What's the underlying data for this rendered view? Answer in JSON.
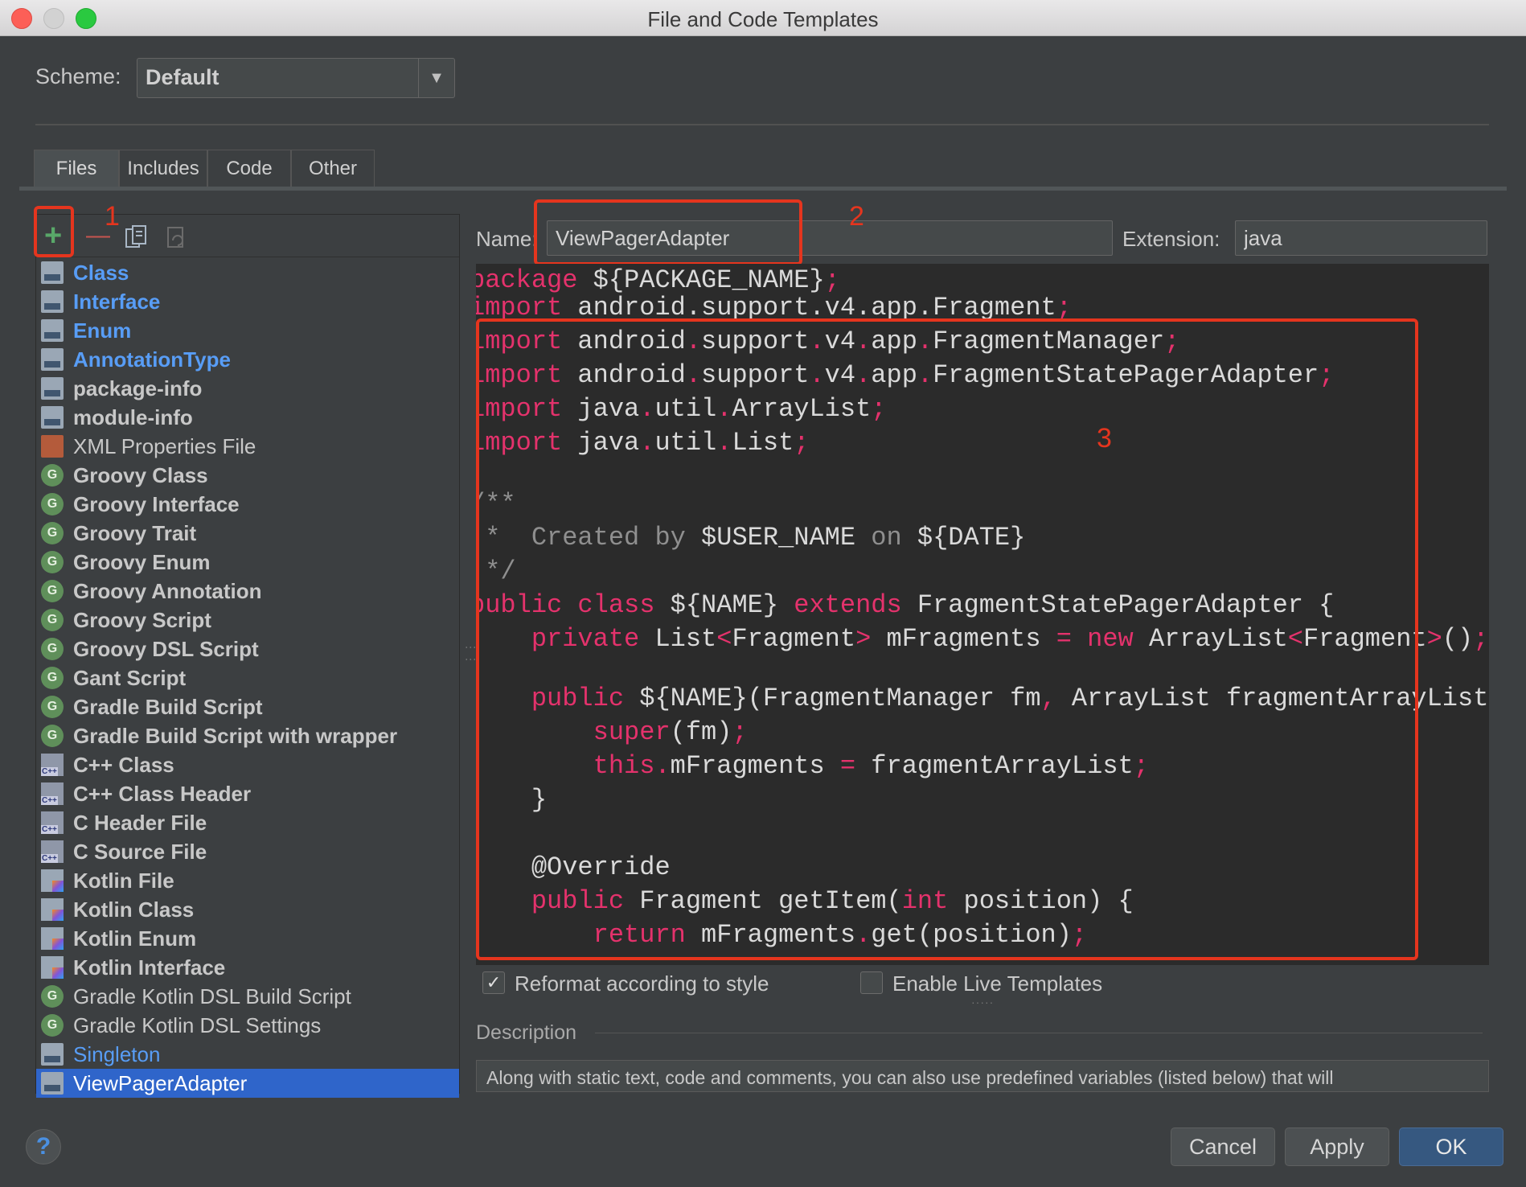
{
  "window": {
    "title": "File and Code Templates"
  },
  "scheme": {
    "label": "Scheme:",
    "value": "Default"
  },
  "tabs": [
    {
      "label": "Files",
      "active": true
    },
    {
      "label": "Includes",
      "active": false
    },
    {
      "label": "Code",
      "active": false
    },
    {
      "label": "Other",
      "active": false
    }
  ],
  "toolbar": {
    "add": "+",
    "remove": "—"
  },
  "templates": [
    {
      "label": "Class",
      "icon": "java-file-icon",
      "style": "blue"
    },
    {
      "label": "Interface",
      "icon": "java-file-icon",
      "style": "blue"
    },
    {
      "label": "Enum",
      "icon": "java-file-icon",
      "style": "blue"
    },
    {
      "label": "AnnotationType",
      "icon": "java-file-icon",
      "style": "blue"
    },
    {
      "label": "package-info",
      "icon": "java-file-icon",
      "style": "bold"
    },
    {
      "label": "module-info",
      "icon": "java-file-icon",
      "style": "bold"
    },
    {
      "label": "XML Properties File",
      "icon": "xml-file-icon",
      "style": "normal"
    },
    {
      "label": "Groovy Class",
      "icon": "groovy-icon",
      "style": "bold"
    },
    {
      "label": "Groovy Interface",
      "icon": "groovy-icon",
      "style": "bold"
    },
    {
      "label": "Groovy Trait",
      "icon": "groovy-icon",
      "style": "bold"
    },
    {
      "label": "Groovy Enum",
      "icon": "groovy-icon",
      "style": "bold"
    },
    {
      "label": "Groovy Annotation",
      "icon": "groovy-icon",
      "style": "bold"
    },
    {
      "label": "Groovy Script",
      "icon": "groovy-icon",
      "style": "bold"
    },
    {
      "label": "Groovy DSL Script",
      "icon": "groovy-icon",
      "style": "bold"
    },
    {
      "label": "Gant Script",
      "icon": "groovy-icon",
      "style": "bold"
    },
    {
      "label": "Gradle Build Script",
      "icon": "groovy-icon",
      "style": "bold"
    },
    {
      "label": "Gradle Build Script with wrapper",
      "icon": "groovy-icon",
      "style": "bold"
    },
    {
      "label": "C++ Class",
      "icon": "cpp-file-icon",
      "style": "bold"
    },
    {
      "label": "C++ Class Header",
      "icon": "cpp-file-icon",
      "style": "bold"
    },
    {
      "label": "C Header File",
      "icon": "cpp-file-icon",
      "style": "bold"
    },
    {
      "label": "C Source File",
      "icon": "cpp-file-icon",
      "style": "bold"
    },
    {
      "label": "Kotlin File",
      "icon": "kotlin-file-icon",
      "style": "bold"
    },
    {
      "label": "Kotlin Class",
      "icon": "kotlin-file-icon",
      "style": "bold"
    },
    {
      "label": "Kotlin Enum",
      "icon": "kotlin-file-icon",
      "style": "bold"
    },
    {
      "label": "Kotlin Interface",
      "icon": "kotlin-file-icon",
      "style": "bold"
    },
    {
      "label": "Gradle Kotlin DSL Build Script",
      "icon": "groovy-icon",
      "style": "normal"
    },
    {
      "label": "Gradle Kotlin DSL Settings",
      "icon": "groovy-icon",
      "style": "normal"
    },
    {
      "label": "Singleton",
      "icon": "java-file-icon",
      "style": "blue-normal"
    },
    {
      "label": "ViewPagerAdapter",
      "icon": "java-file-icon",
      "style": "selected"
    }
  ],
  "editor": {
    "name_label": "Name:",
    "name_value": "ViewPagerAdapter",
    "extension_label": "Extension:",
    "extension_value": "java",
    "code_lines": [
      [
        [
          "pu",
          "package"
        ],
        [
          "tx",
          " ${PACKAGE_NAME}"
        ],
        [
          "pu",
          ";"
        ]
      ],
      [
        [
          "pu",
          "import"
        ],
        [
          "tx",
          " android.support.v4.app.Fragment"
        ],
        [
          "pu",
          ";"
        ]
      ],
      [
        [
          "pu",
          "import"
        ],
        [
          "tx",
          " android"
        ],
        [
          "pu",
          "."
        ],
        [
          "tx",
          "support"
        ],
        [
          "pu",
          "."
        ],
        [
          "tx",
          "v4"
        ],
        [
          "pu",
          "."
        ],
        [
          "tx",
          "app"
        ],
        [
          "pu",
          "."
        ],
        [
          "tx",
          "FragmentManager"
        ],
        [
          "pu",
          ";"
        ]
      ],
      [
        [
          "pu",
          "import"
        ],
        [
          "tx",
          " android"
        ],
        [
          "pu",
          "."
        ],
        [
          "tx",
          "support"
        ],
        [
          "pu",
          "."
        ],
        [
          "tx",
          "v4"
        ],
        [
          "pu",
          "."
        ],
        [
          "tx",
          "app"
        ],
        [
          "pu",
          "."
        ],
        [
          "tx",
          "FragmentStatePagerAdapter"
        ],
        [
          "pu",
          ";"
        ]
      ],
      [
        [
          "pu",
          "import"
        ],
        [
          "tx",
          " java"
        ],
        [
          "pu",
          "."
        ],
        [
          "tx",
          "util"
        ],
        [
          "pu",
          "."
        ],
        [
          "tx",
          "ArrayList"
        ],
        [
          "pu",
          ";"
        ]
      ],
      [
        [
          "pu",
          "import"
        ],
        [
          "tx",
          " java"
        ],
        [
          "pu",
          "."
        ],
        [
          "tx",
          "util"
        ],
        [
          "pu",
          "."
        ],
        [
          "tx",
          "List"
        ],
        [
          "pu",
          ";"
        ]
      ],
      [],
      [
        [
          "cm",
          "/**"
        ]
      ],
      [
        [
          "cm",
          " *  Created by "
        ],
        [
          "tx",
          "$USER_NAME"
        ],
        [
          "cm",
          " on "
        ],
        [
          "tx",
          "${DATE}"
        ]
      ],
      [
        [
          "cm",
          " */"
        ]
      ],
      [
        [
          "kw",
          "public class"
        ],
        [
          "tx",
          " ${NAME} "
        ],
        [
          "kw",
          "extends"
        ],
        [
          "tx",
          " FragmentStatePagerAdapter {"
        ]
      ],
      [
        [
          "tx",
          "    "
        ],
        [
          "kw",
          "private"
        ],
        [
          "tx",
          " List"
        ],
        [
          "pu",
          "<"
        ],
        [
          "tx",
          "Fragment"
        ],
        [
          "pu",
          ">"
        ],
        [
          "tx",
          " mFragments "
        ],
        [
          "pu",
          "="
        ],
        [
          "tx",
          " "
        ],
        [
          "kw",
          "new"
        ],
        [
          "tx",
          " ArrayList"
        ],
        [
          "pu",
          "<"
        ],
        [
          "tx",
          "Fragment"
        ],
        [
          "pu",
          ">"
        ],
        [
          "tx",
          "()"
        ],
        [
          "pu",
          ";"
        ]
      ],
      [],
      [
        [
          "tx",
          "    "
        ],
        [
          "kw",
          "public"
        ],
        [
          "tx",
          " ${NAME}(FragmentManager fm"
        ],
        [
          "pu",
          ","
        ],
        [
          "tx",
          " ArrayList fragmentArrayList) {"
        ]
      ],
      [
        [
          "tx",
          "        "
        ],
        [
          "kw",
          "super"
        ],
        [
          "tx",
          "(fm)"
        ],
        [
          "pu",
          ";"
        ]
      ],
      [
        [
          "tx",
          "        "
        ],
        [
          "kw",
          "this"
        ],
        [
          "pu",
          "."
        ],
        [
          "tx",
          "mFragments "
        ],
        [
          "pu",
          "="
        ],
        [
          "tx",
          " fragmentArrayList"
        ],
        [
          "pu",
          ";"
        ]
      ],
      [
        [
          "tx",
          "    }"
        ]
      ],
      [],
      [
        [
          "tx",
          "    @Override"
        ]
      ],
      [
        [
          "tx",
          "    "
        ],
        [
          "kw",
          "public"
        ],
        [
          "tx",
          " Fragment getItem("
        ],
        [
          "kw",
          "int"
        ],
        [
          "tx",
          " position) {"
        ]
      ],
      [
        [
          "tx",
          "        "
        ],
        [
          "kw",
          "return"
        ],
        [
          "tx",
          " mFragments"
        ],
        [
          "pu",
          "."
        ],
        [
          "tx",
          "get(position)"
        ],
        [
          "pu",
          ";"
        ]
      ]
    ]
  },
  "options": {
    "reformat_label": "Reformat according to style",
    "reformat_checked": true,
    "live_templates_label": "Enable Live Templates",
    "live_templates_checked": false
  },
  "description": {
    "label": "Description",
    "text": "Along with static text, code and comments, you can also use predefined variables (listed below) that will"
  },
  "buttons": {
    "help": "?",
    "cancel": "Cancel",
    "apply": "Apply",
    "ok": "OK"
  },
  "annotations": {
    "n1": "1",
    "n2": "2",
    "n3": "3"
  },
  "colors": {
    "accent_red": "#e5351e",
    "selection": "#2f65ca",
    "keyword": "#e4326c",
    "link_blue": "#589df6"
  }
}
